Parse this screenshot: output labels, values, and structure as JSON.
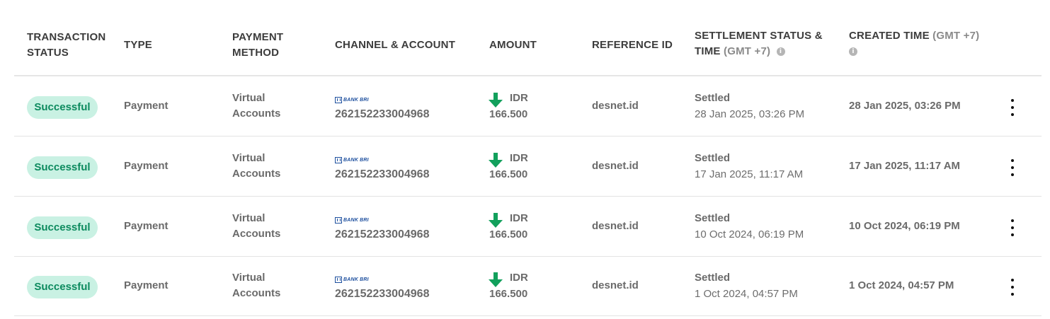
{
  "headers": {
    "transaction_status": [
      "TRANSACTION",
      "STATUS"
    ],
    "type": "TYPE",
    "payment_method": [
      "PAYMENT",
      "METHOD"
    ],
    "channel_account": "CHANNEL & ACCOUNT",
    "amount": "AMOUNT",
    "reference_id": "REFERENCE ID",
    "settlement_status": [
      "SETTLEMENT STATUS &",
      "TIME"
    ],
    "settlement_gmt": "(GMT +7)",
    "created_time": "CREATED TIME",
    "created_gmt": "(GMT +7)"
  },
  "info_icon": "i",
  "colors": {
    "badge_bg": "#c9f1e3",
    "badge_text": "#0c8a5e",
    "arrow": "#12a05c",
    "bank_logo": "#1d4f9e"
  },
  "icons": {
    "arrow": "arrow-down-icon",
    "bank": "bank-bri-logo",
    "menu": "kebab-menu-icon"
  },
  "rows": [
    {
      "status": "Successful",
      "type": "Payment",
      "method": [
        "Virtual",
        "Accounts"
      ],
      "bank_logo": "BANK BRI",
      "account": "262152233004968",
      "currency": "IDR",
      "amount": "166.500",
      "reference_id": "desnet.id",
      "settlement_status": "Settled",
      "settlement_time": "28 Jan 2025, 03:26 PM",
      "created_time": "28 Jan 2025, 03:26 PM"
    },
    {
      "status": "Successful",
      "type": "Payment",
      "method": [
        "Virtual",
        "Accounts"
      ],
      "bank_logo": "BANK BRI",
      "account": "262152233004968",
      "currency": "IDR",
      "amount": "166.500",
      "reference_id": "desnet.id",
      "settlement_status": "Settled",
      "settlement_time": "17 Jan 2025, 11:17 AM",
      "created_time": "17 Jan 2025, 11:17 AM"
    },
    {
      "status": "Successful",
      "type": "Payment",
      "method": [
        "Virtual",
        "Accounts"
      ],
      "bank_logo": "BANK BRI",
      "account": "262152233004968",
      "currency": "IDR",
      "amount": "166.500",
      "reference_id": "desnet.id",
      "settlement_status": "Settled",
      "settlement_time": "10 Oct 2024, 06:19 PM",
      "created_time": "10 Oct 2024, 06:19 PM"
    },
    {
      "status": "Successful",
      "type": "Payment",
      "method": [
        "Virtual",
        "Accounts"
      ],
      "bank_logo": "BANK BRI",
      "account": "262152233004968",
      "currency": "IDR",
      "amount": "166.500",
      "reference_id": "desnet.id",
      "settlement_status": "Settled",
      "settlement_time": "1 Oct 2024, 04:57 PM",
      "created_time": "1 Oct 2024, 04:57 PM"
    }
  ]
}
